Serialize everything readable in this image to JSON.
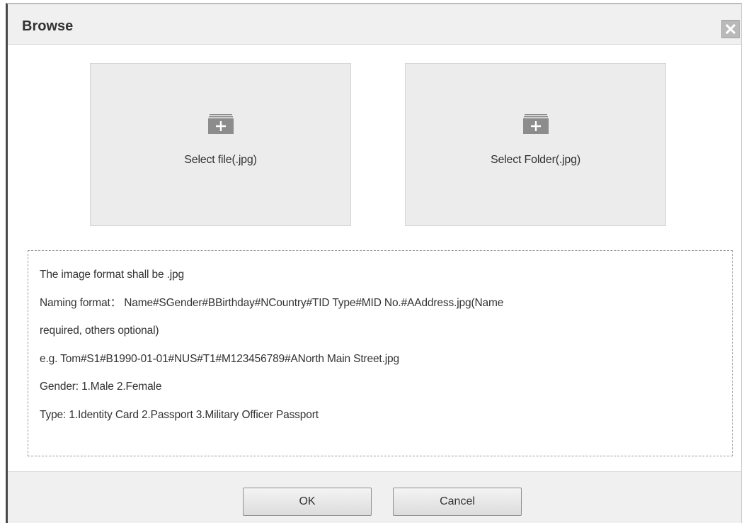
{
  "dialog": {
    "title": "Browse",
    "close_icon": "close-icon"
  },
  "select_file": {
    "icon": "add-folder-icon",
    "label": "Select file(.jpg)"
  },
  "select_folder": {
    "icon": "add-folder-icon",
    "label": "Select Folder(.jpg)"
  },
  "info": {
    "lines": [
      "The image format shall be .jpg",
      "Naming format： Name#SGender#BBirthday#NCountry#TID Type#MID No.#AAddress.jpg(Name",
      "required, others optional)",
      "e.g. Tom#S1#B1990-01-01#NUS#T1#M123456789#ANorth Main Street.jpg",
      "Gender: 1.Male 2.Female",
      "Type: 1.Identity Card 2.Passport 3.Military Officer Passport"
    ]
  },
  "footer": {
    "ok_label": "OK",
    "cancel_label": "Cancel"
  }
}
